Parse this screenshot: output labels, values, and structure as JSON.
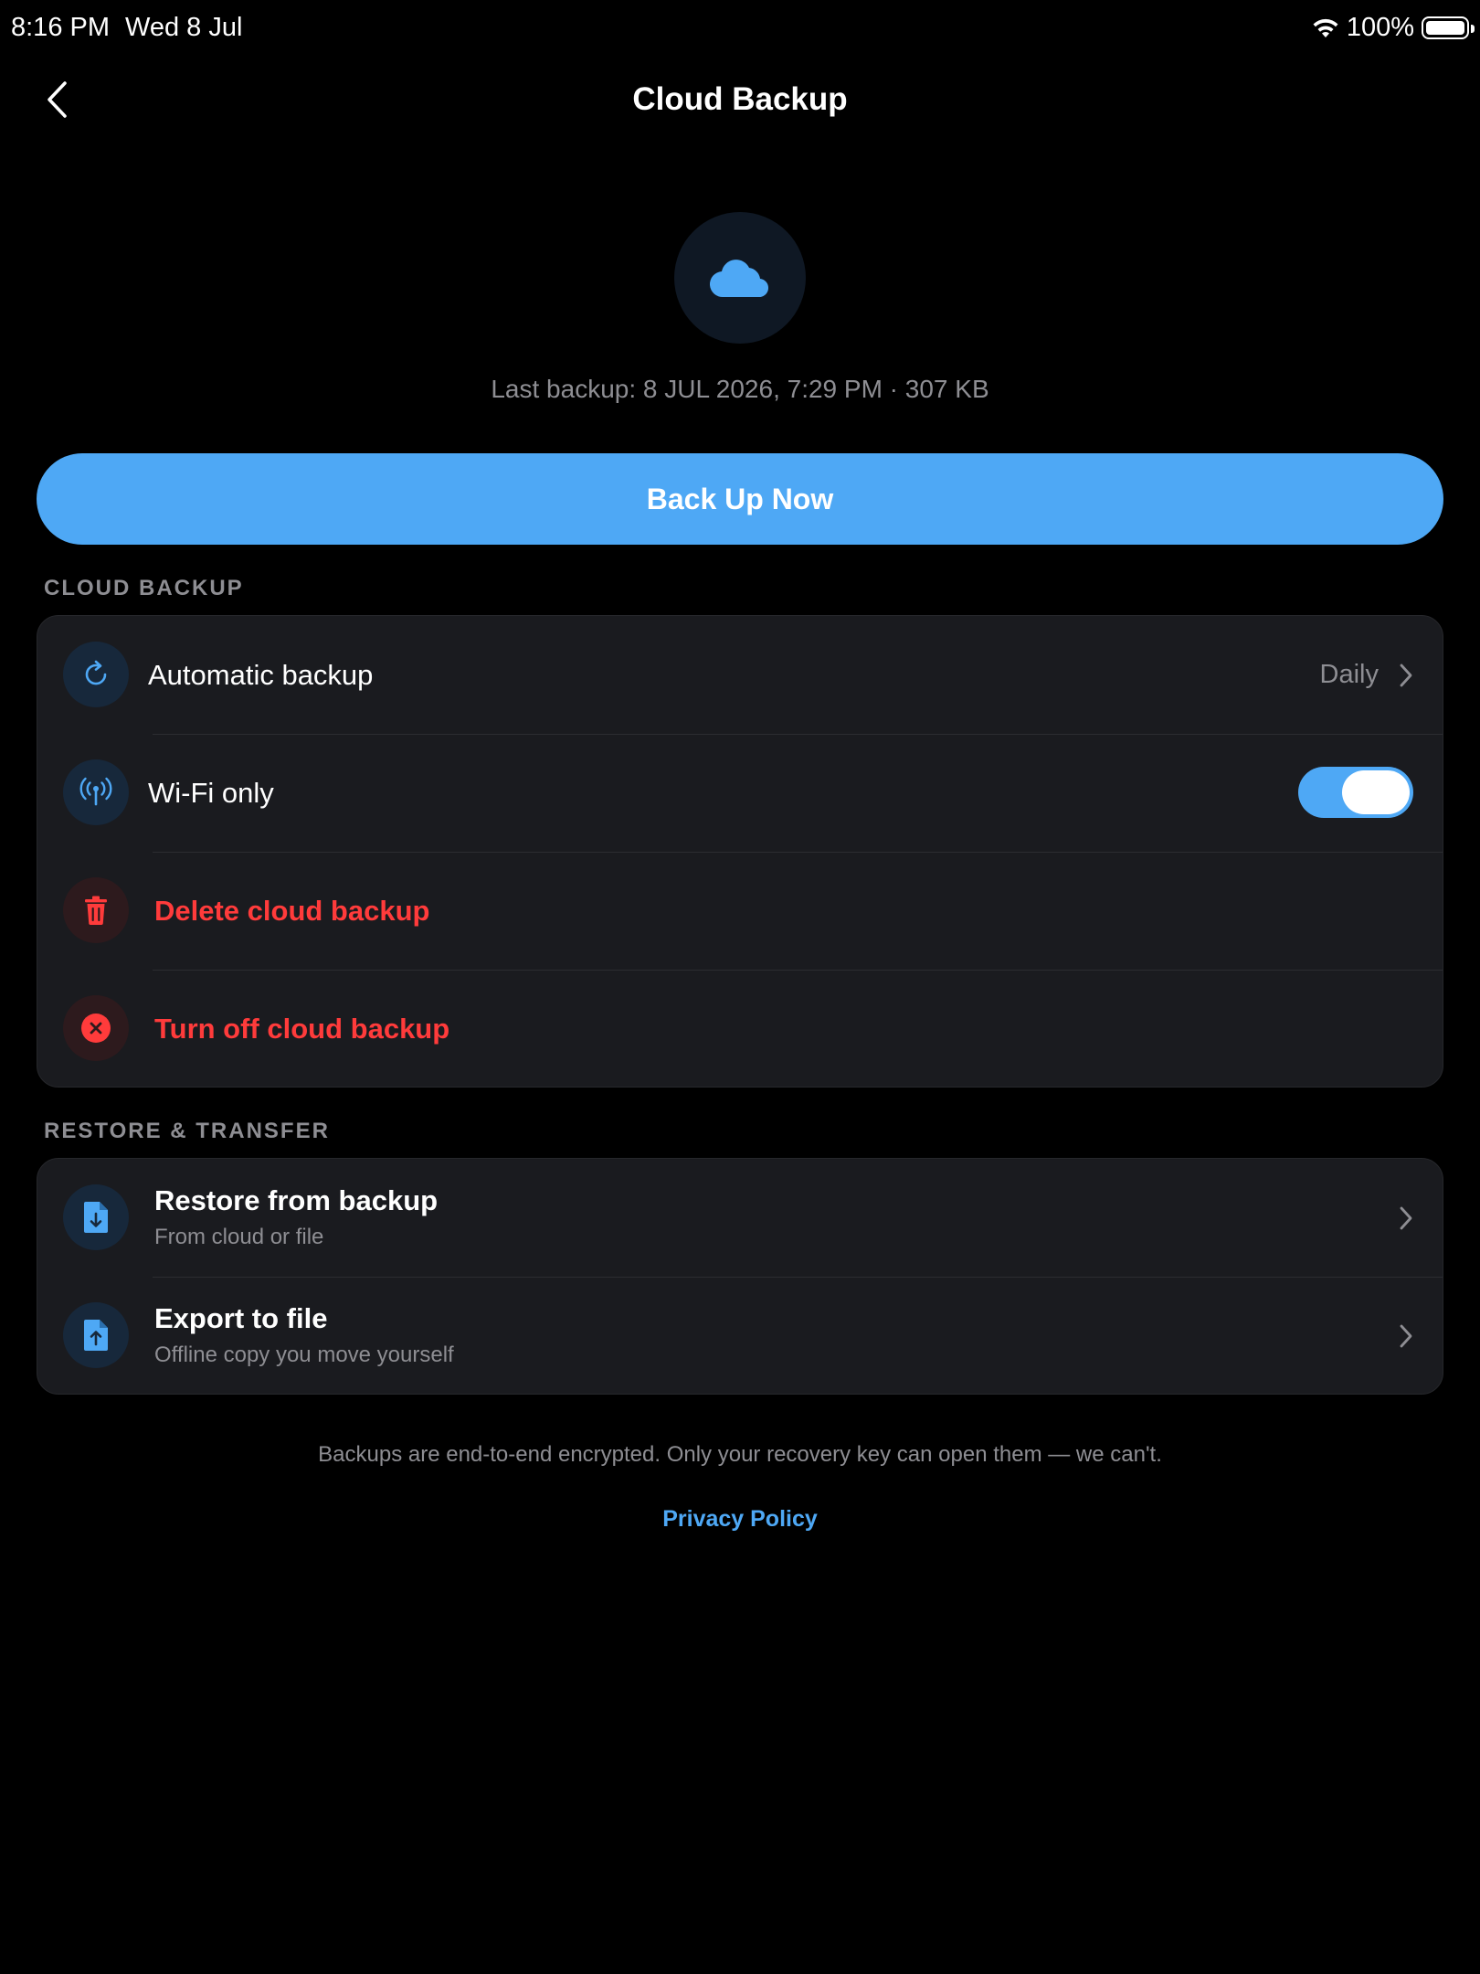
{
  "status_bar": {
    "time": "8:16 PM",
    "date": "Wed 8 Jul",
    "battery": "100%"
  },
  "nav": {
    "title": "Cloud Backup",
    "back_icon": "chevron-left-icon"
  },
  "hero": {
    "icon": "cloud-icon",
    "last_backup": "Last backup: 8 JUL 2026, 7:29 PM · 307 KB"
  },
  "primary_button": "Back Up Now",
  "sections": {
    "cloud_backup": {
      "header": "CLOUD BACKUP",
      "automatic_backup": {
        "label": "Automatic backup",
        "value": "Daily",
        "icon": "refresh-icon"
      },
      "wifi_only": {
        "label": "Wi-Fi only",
        "enabled": true,
        "icon": "antenna-icon"
      },
      "delete_backup": {
        "label": "Delete cloud backup",
        "icon": "trash-icon"
      },
      "turn_off": {
        "label": "Turn off cloud backup",
        "icon": "close-circle-icon"
      }
    },
    "restore_transfer": {
      "header": "RESTORE & TRANSFER",
      "restore": {
        "title": "Restore from backup",
        "subtitle": "From cloud or file",
        "icon": "file-download-icon"
      },
      "export": {
        "title": "Export to file",
        "subtitle": "Offline copy you move yourself",
        "icon": "file-upload-icon"
      }
    }
  },
  "footer": {
    "note": "Backups are end-to-end encrypted. Only your recovery key can open them — we can't.",
    "privacy_link": "Privacy Policy"
  },
  "colors": {
    "accent": "#4ea8f5",
    "destructive": "#ff3b3b",
    "card_bg": "#1a1b1f",
    "background": "#000000"
  }
}
